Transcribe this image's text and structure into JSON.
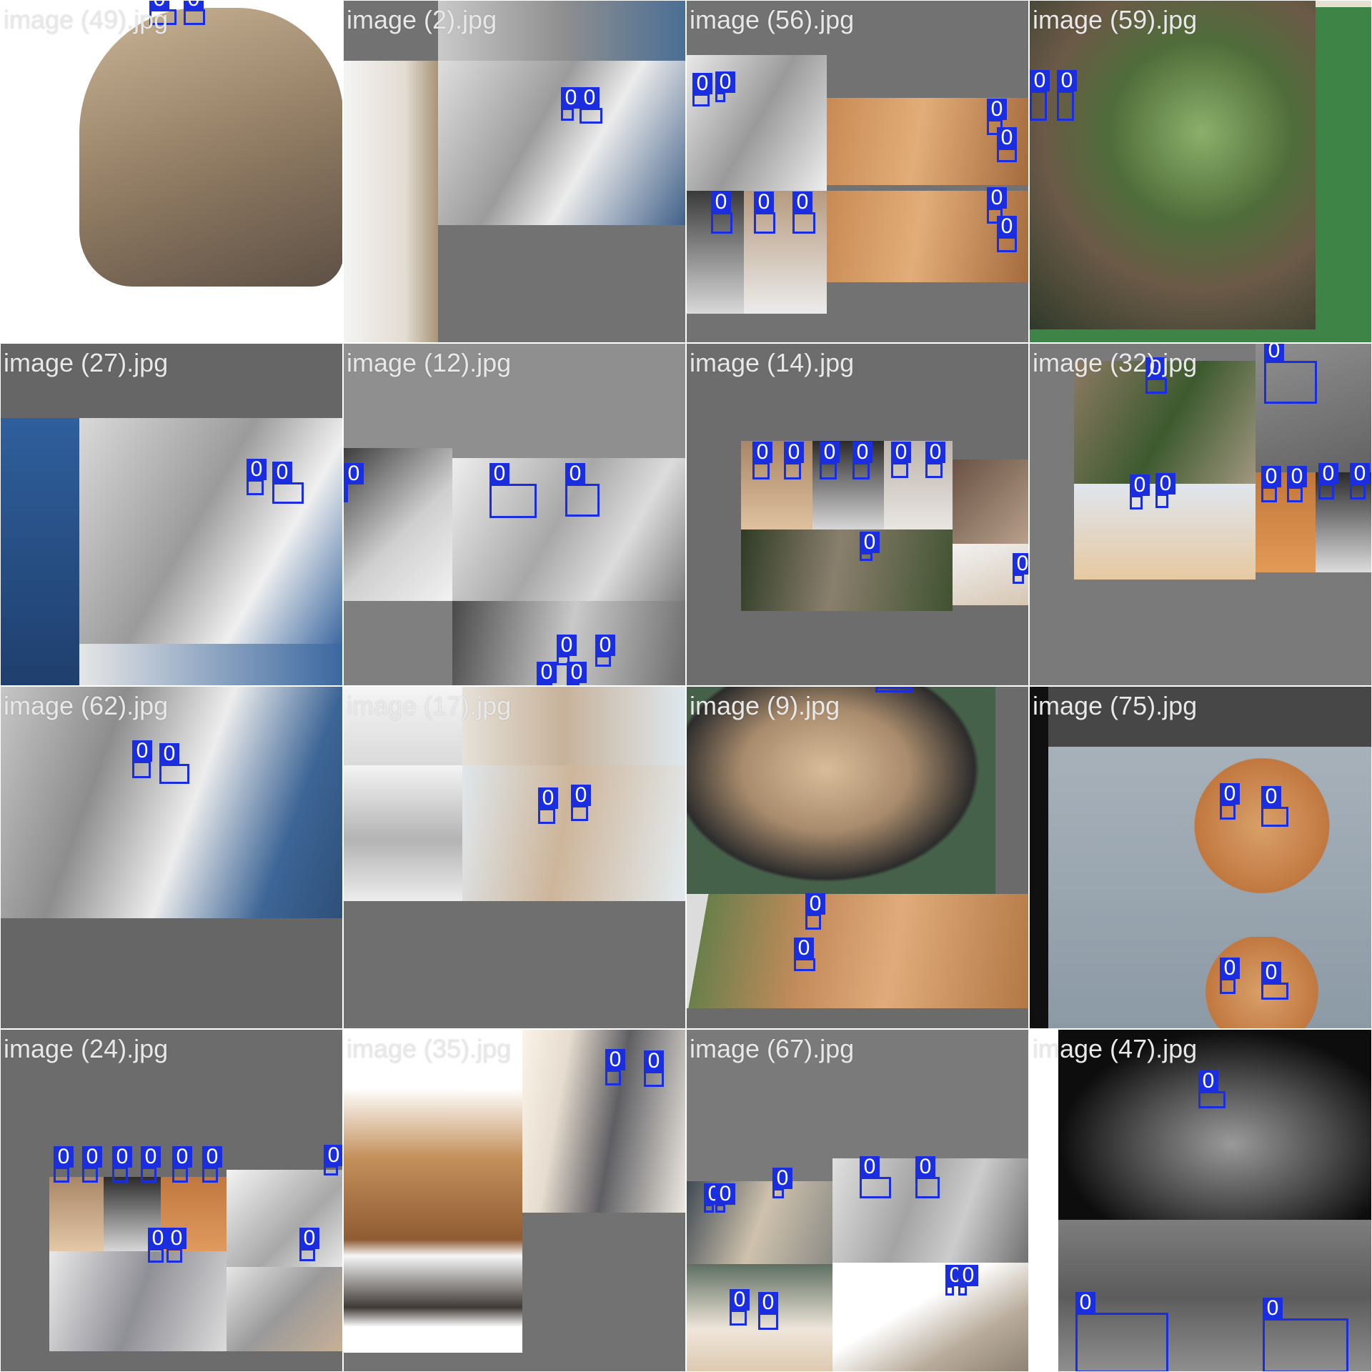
{
  "colors": {
    "box": "#1a2ee0",
    "caption": "#e8e8e8",
    "gray_pad": "#727272"
  },
  "box_label": "0",
  "tiles": [
    {
      "caption": "image (49).jpg"
    },
    {
      "caption": "image (2).jpg"
    },
    {
      "caption": "image (56).jpg"
    },
    {
      "caption": "image (59).jpg"
    },
    {
      "caption": "image (27).jpg"
    },
    {
      "caption": "image (12).jpg"
    },
    {
      "caption": "image (14).jpg"
    },
    {
      "caption": "image (32).jpg"
    },
    {
      "caption": "image (62).jpg"
    },
    {
      "caption": "image (17).jpg"
    },
    {
      "caption": "image (9).jpg"
    },
    {
      "caption": "image (75).jpg"
    },
    {
      "caption": "image (24).jpg"
    },
    {
      "caption": "image (35).jpg"
    },
    {
      "caption": "image (67).jpg"
    },
    {
      "caption": "image (47).jpg"
    }
  ]
}
